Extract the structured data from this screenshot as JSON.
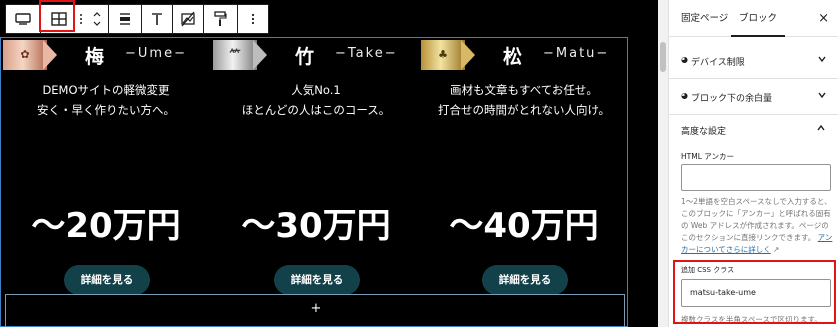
{
  "toolbar": {
    "buttons": [
      "mobile-icon",
      "grid-icon",
      "drag-handle-icon",
      "move-updown-icon",
      "align-justify-icon",
      "align-top-icon",
      "no-image-icon",
      "paint-roller-icon",
      "more-options-icon"
    ]
  },
  "plans": [
    {
      "kanji": "梅",
      "romaji": "−Ume−",
      "line1": "DEMOサイトの軽微変更",
      "line2": "安く・早く作りたい方へ。",
      "price": "〜20万円",
      "button": "詳細を見る",
      "accent": "#c48a6a"
    },
    {
      "kanji": "竹",
      "romaji": "−Take−",
      "line1": "人気No.1",
      "line2": "ほとんどの人はこのコース。",
      "price": "〜30万円",
      "button": "詳細を見る",
      "accent": "#9a9a9a"
    },
    {
      "kanji": "松",
      "romaji": "−Matu−",
      "line1": "画材も文章もすべてお任せ。",
      "line2": "打合せの時間がとれない人向け。",
      "price": "〜40万円",
      "button": "詳細を見る",
      "accent": "#c9a84a"
    }
  ],
  "add_block": "+",
  "sidebar": {
    "tab_page": "固定ページ",
    "tab_block": "ブロック",
    "close": "×",
    "panels": [
      {
        "label": "デバイス制限"
      },
      {
        "label": "ブロック下の余白量"
      }
    ],
    "advanced": {
      "title": "高度な設定",
      "html_anchor_label": "HTML アンカー",
      "html_anchor_value": "",
      "help_text": "1〜2単語を空白スペースなしで入力すると、このブロックに「アンカー」と呼ばれる固有の Web アドレスが作成されます。ページのこのセクションに直接リンクできます。",
      "help_link": "アンカーについてさらに詳しく",
      "css_label": "追加 CSS クラス",
      "css_value": "matsu-take-ume",
      "css_help": "複数クラスを半角スペースで区切ります。"
    }
  },
  "colors": {
    "canvas_bg": "#000000",
    "button_bg": "#12414a",
    "highlight": "#e01414",
    "link": "#2271b1"
  }
}
